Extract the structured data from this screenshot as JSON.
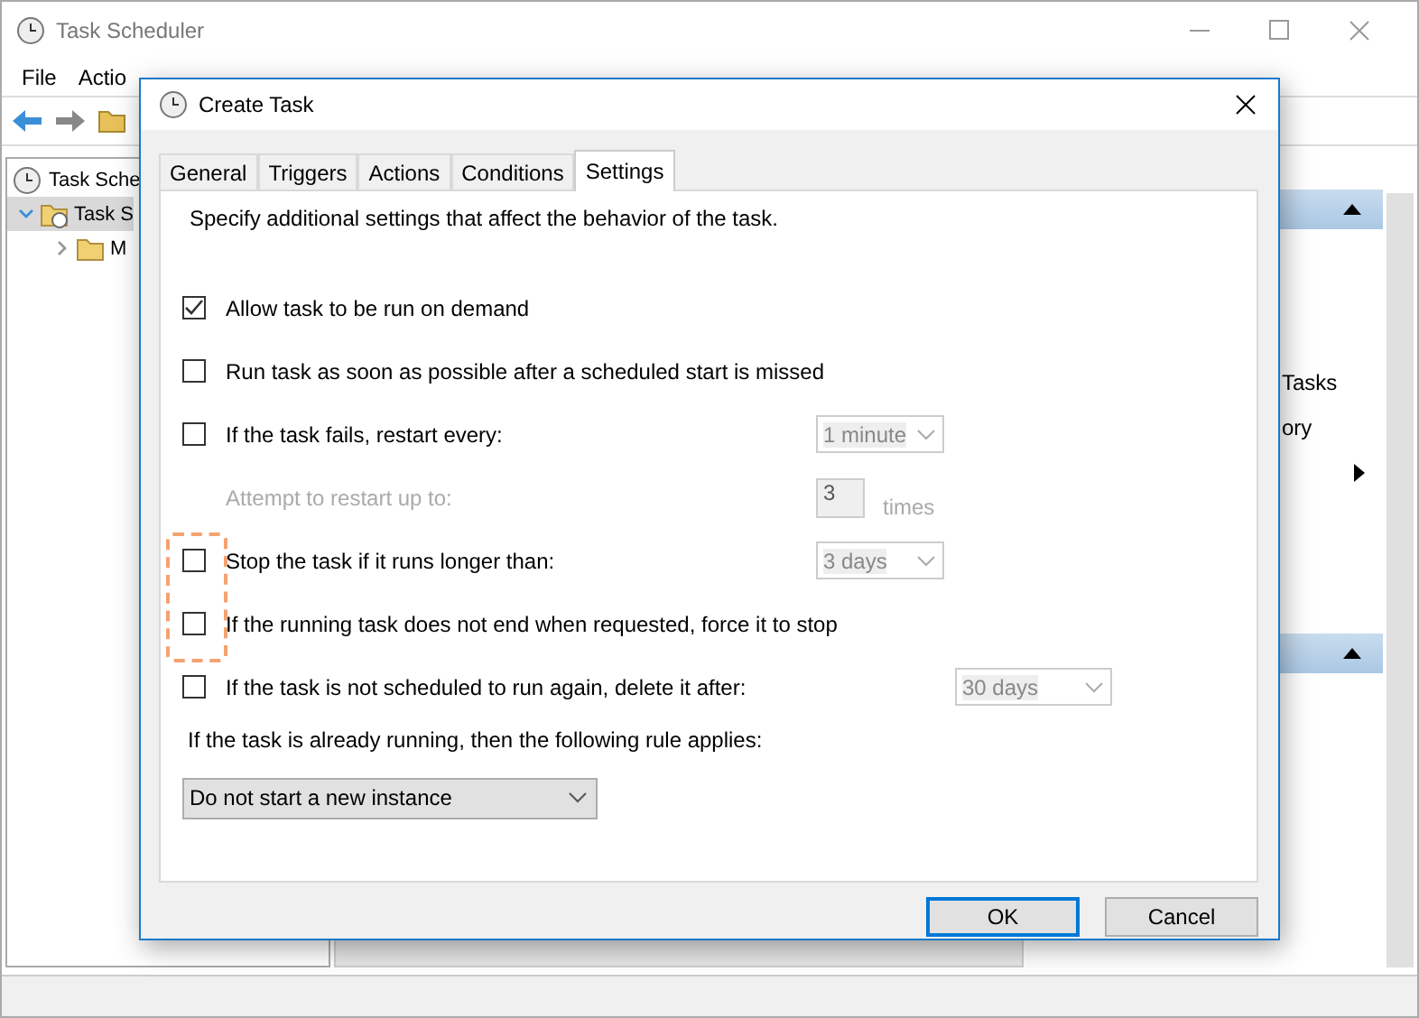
{
  "window": {
    "title": "Task Scheduler"
  },
  "menu": [
    "File",
    "Actio"
  ],
  "tree": [
    {
      "label": "Task Sche",
      "selected": false,
      "children": [
        {
          "label": "Task S",
          "selected": true,
          "expanded": true,
          "children": [
            {
              "label": "M",
              "selected": false,
              "expanded": false
            }
          ]
        }
      ]
    }
  ],
  "actions_pane": {
    "items": [
      {
        "kind": "header"
      },
      {
        "kind": "spacer"
      },
      {
        "kind": "text",
        "label": "Tasks"
      },
      {
        "kind": "text",
        "label": "ory"
      },
      {
        "kind": "submenu"
      },
      {
        "kind": "blank"
      },
      {
        "kind": "header"
      }
    ]
  },
  "dialog": {
    "title": "Create Task",
    "tabs": [
      {
        "label": "General",
        "selected": false
      },
      {
        "label": "Triggers",
        "selected": false
      },
      {
        "label": "Actions",
        "selected": false
      },
      {
        "label": "Conditions",
        "selected": false
      },
      {
        "label": "Settings",
        "selected": true
      }
    ],
    "description": "Specify additional settings that affect the behavior of the task.",
    "settings": [
      {
        "kind": "checkbox",
        "label": "Allow task to be run on demand",
        "checked": true,
        "highlighted": false
      },
      {
        "kind": "checkbox",
        "label": "Run task as soon as possible after a scheduled start is missed",
        "checked": false,
        "highlighted": false
      },
      {
        "kind": "checkbox",
        "label": "If the task fails, restart every:",
        "checked": false,
        "highlighted": false,
        "dropdown": {
          "value": "1 minute",
          "disabled": true
        }
      },
      {
        "kind": "spin",
        "label": "Attempt to restart up to:",
        "disabled": true,
        "value": "3",
        "suffix": "times",
        "highlighted": false
      },
      {
        "kind": "checkbox",
        "label": "Stop the task if it runs longer than:",
        "checked": false,
        "highlighted": true,
        "dropdown": {
          "value": "3 days",
          "disabled": true
        }
      },
      {
        "kind": "checkbox",
        "label": "If the running task does not end when requested, force it to stop",
        "checked": false,
        "highlighted": true
      },
      {
        "kind": "checkbox",
        "label": "If the task is not scheduled to run again, delete it after:",
        "checked": false,
        "highlighted": false,
        "dropdown": {
          "value": "30 days",
          "disabled": true
        }
      },
      {
        "kind": "text",
        "label": "If the task is already running, then the following rule applies:",
        "highlighted": false
      },
      {
        "kind": "select",
        "label": "Do not start a new instance",
        "highlighted": false
      }
    ],
    "buttons": [
      {
        "label": "OK",
        "default": true
      },
      {
        "label": "Cancel",
        "default": false
      }
    ]
  }
}
